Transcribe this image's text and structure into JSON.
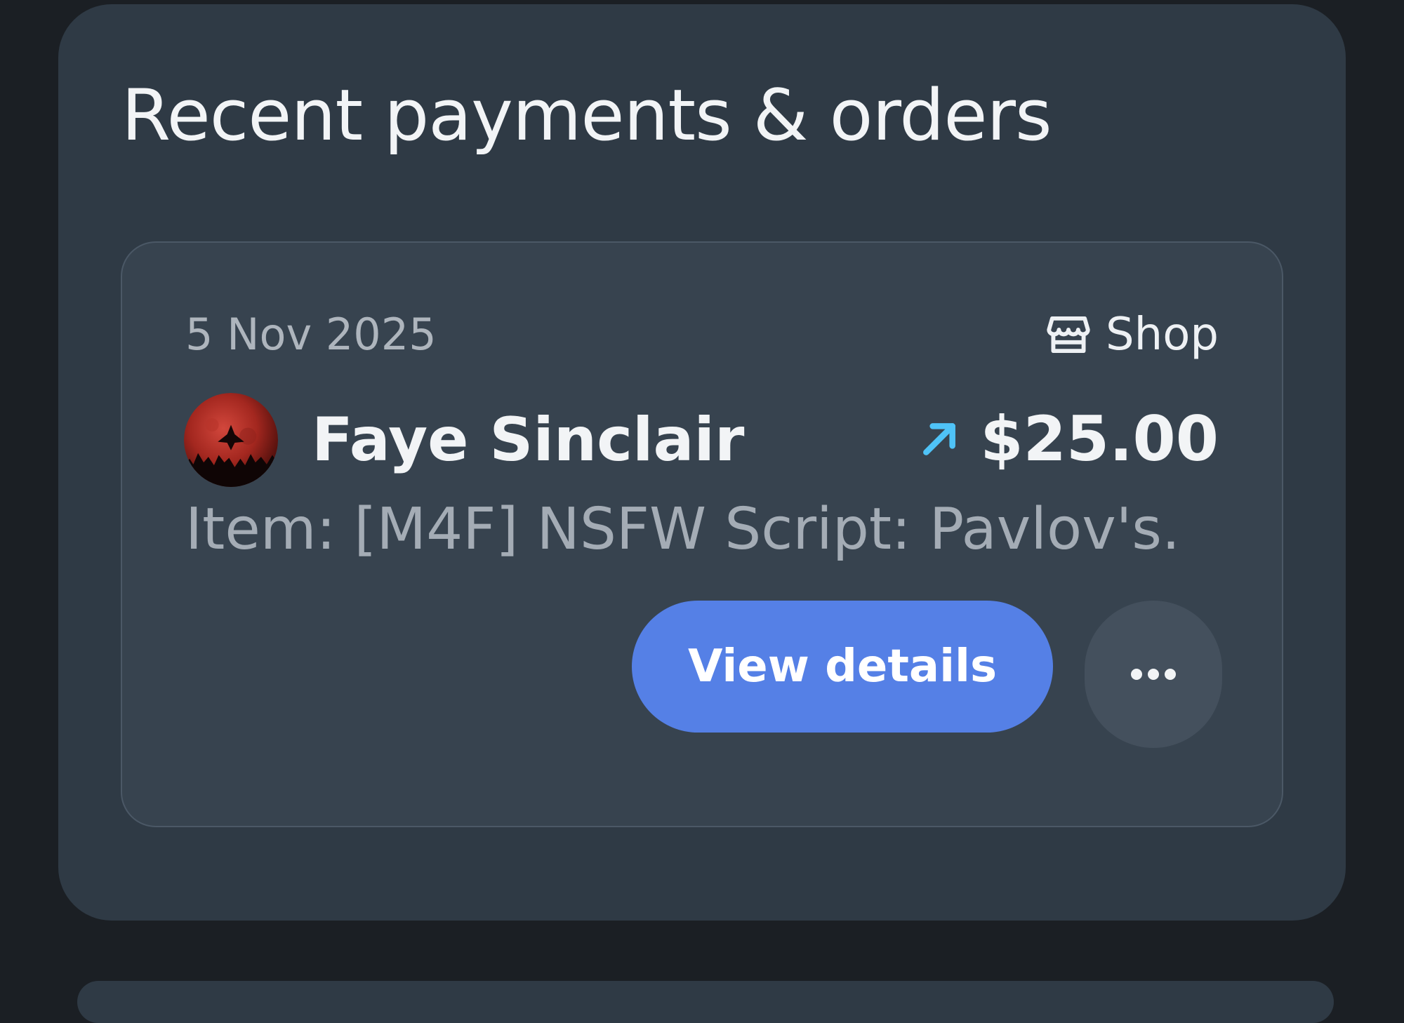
{
  "section": {
    "title": "Recent payments & orders"
  },
  "order": {
    "date": "5 Nov 2025",
    "source_label": "Shop",
    "source_icon": "store-icon",
    "customer_name": "Faye Sinclair",
    "avatar_icon": "avatar-image",
    "direction_icon": "arrow-up-right-icon",
    "amount": "$25.00",
    "item_text": "Item: [M4F] NSFW Script: Pavlov's...",
    "view_button_label": "View details",
    "more_button_icon": "more-horizontal-icon"
  },
  "colors": {
    "page_background": "#1b1f24",
    "section_background": "#2f3a45",
    "card_background": "#37434f",
    "primary_button": "#5580e6",
    "arrow_accent": "#4fc3f7",
    "muted_text": "#a4acb5"
  }
}
